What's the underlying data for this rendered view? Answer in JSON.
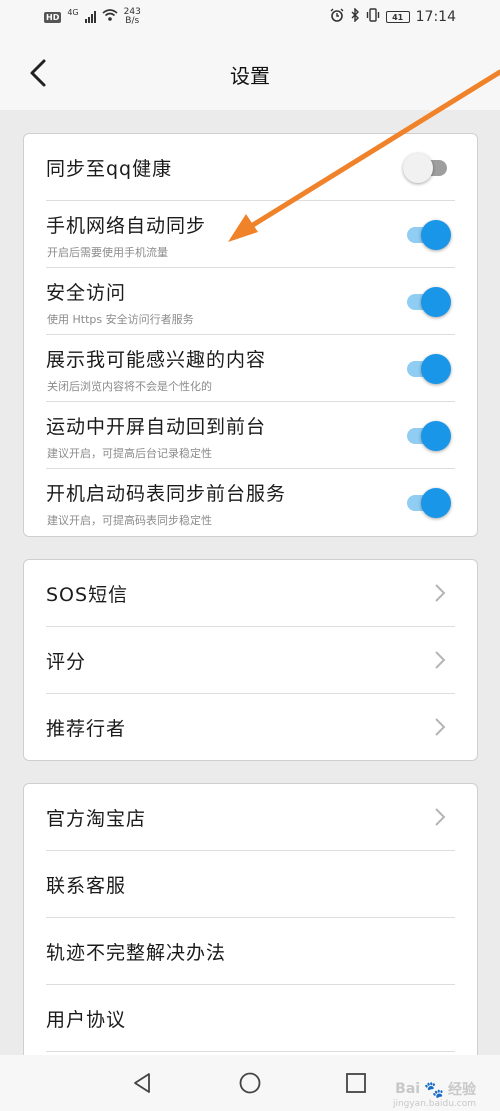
{
  "status_bar": {
    "hd": "HD",
    "network": "4G",
    "speed_value": "243",
    "speed_unit": "B/s",
    "battery": "41",
    "time": "17:14"
  },
  "header": {
    "title": "设置"
  },
  "toggle_section": {
    "items": [
      {
        "label": "同步至qq健康",
        "sub": "",
        "on": false
      },
      {
        "label": "手机网络自动同步",
        "sub": "开启后需要使用手机流量",
        "on": true
      },
      {
        "label": "安全访问",
        "sub": "使用 Https 安全访问行者服务",
        "on": true
      },
      {
        "label": "展示我可能感兴趣的内容",
        "sub": "关闭后浏览内容将不会是个性化的",
        "on": true
      },
      {
        "label": "运动中开屏自动回到前台",
        "sub": "建议开启，可提高后台记录稳定性",
        "on": true
      },
      {
        "label": "开机启动码表同步前台服务",
        "sub": "建议开启，可提高码表同步稳定性",
        "on": true
      }
    ]
  },
  "link_section_1": {
    "items": [
      {
        "label": "SOS短信"
      },
      {
        "label": "评分"
      },
      {
        "label": "推荐行者"
      }
    ]
  },
  "link_section_2": {
    "items": [
      {
        "label": "官方淘宝店",
        "chevron": true
      },
      {
        "label": "联系客服",
        "chevron": false
      },
      {
        "label": "轨迹不完整解决办法",
        "chevron": false
      },
      {
        "label": "用户协议",
        "chevron": false
      }
    ]
  },
  "watermark": {
    "brand": "Bai",
    "brand2": "经验",
    "domain": "jingyan.baidu.com"
  },
  "colors": {
    "accent": "#1a96e8",
    "arrow": "#f0822a"
  }
}
